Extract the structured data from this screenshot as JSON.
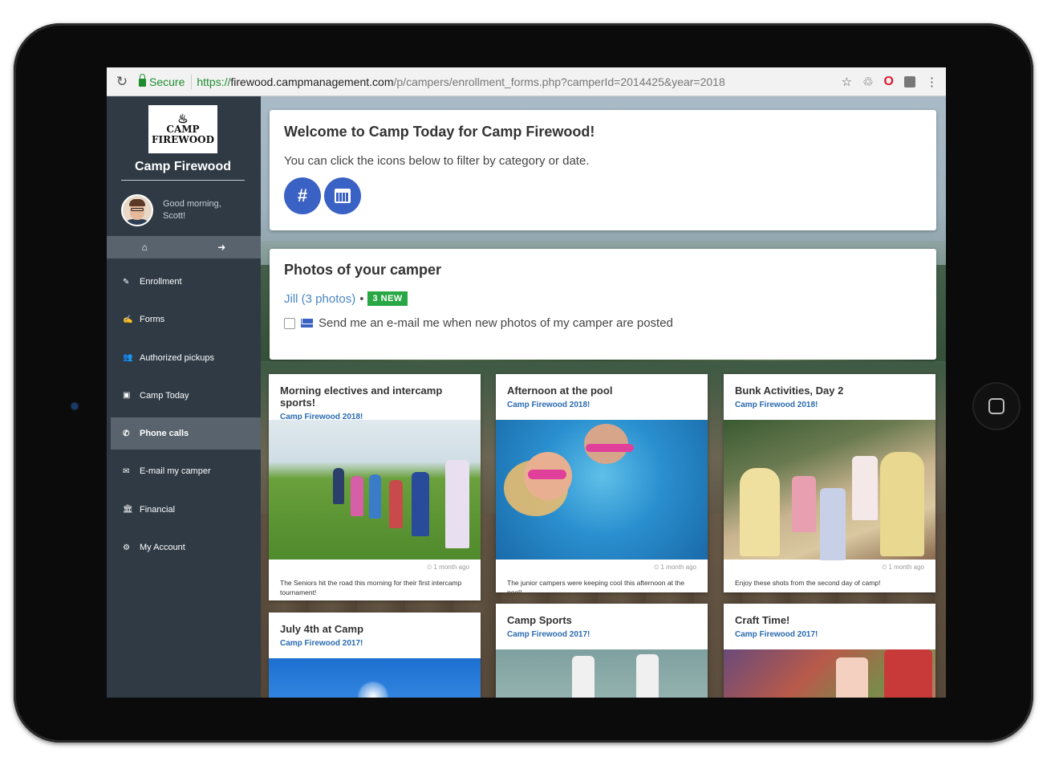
{
  "browser": {
    "secure_label": "Secure",
    "url_scheme": "https://",
    "url_host": "firewood.campmanagement.com",
    "url_path": "/p/campers/enrollment_forms.php?camperId=2014425&year=2018",
    "icons": [
      "reload-icon",
      "star-icon",
      "recycle-icon",
      "opera-icon",
      "extension-icon",
      "menu-icon"
    ]
  },
  "sidebar": {
    "logo_line1": "CAMP",
    "logo_line2": "FIREWOOD",
    "camp_name": "Camp Firewood",
    "greeting_line1": "Good morning,",
    "greeting_line2": "Scott!",
    "quick_icons": [
      "home-icon",
      "sign-out-icon"
    ],
    "items": [
      {
        "label": "Enrollment",
        "icon": "pencil-icon",
        "glyph": "✎"
      },
      {
        "label": "Forms",
        "icon": "edit-icon",
        "glyph": "✍"
      },
      {
        "label": "Authorized pickups",
        "icon": "users-icon",
        "glyph": "👥"
      },
      {
        "label": "Camp Today",
        "icon": "image-icon",
        "glyph": "▣"
      },
      {
        "label": "Phone calls",
        "icon": "phone-icon",
        "glyph": "✆"
      },
      {
        "label": "E-mail my camper",
        "icon": "envelope-icon",
        "glyph": "✉"
      },
      {
        "label": "Financial",
        "icon": "bank-icon",
        "glyph": "🏛"
      },
      {
        "label": "My Account",
        "icon": "gear-icon",
        "glyph": "⚙"
      }
    ],
    "active_item": "Phone calls"
  },
  "welcome": {
    "title": "Welcome to Camp Today for Camp Firewood!",
    "text": "You can click the icons below to filter by category or date.",
    "filter_buttons": [
      "hashtag-icon",
      "calendar-icon"
    ]
  },
  "photos": {
    "title": "Photos of your camper",
    "camper_link": "Jill (3 photos)",
    "separator": "•",
    "new_badge": "3 NEW",
    "notify_label": "Send me an e-mail me when new photos of my camper are posted",
    "notify_checked": false
  },
  "posts": [
    {
      "title": "Morning electives and intercamp sports!",
      "album": "Camp Firewood 2018!",
      "time": "⏲ 1 month ago",
      "caption": "The Seniors hit the road this morning for their first intercamp tournament!"
    },
    {
      "title": "Afternoon at the pool",
      "album": "Camp Firewood 2018!",
      "time": "⏲ 1 month ago",
      "caption": "The junior campers were keeping cool this afternoon at the pool!"
    },
    {
      "title": "Bunk Activities, Day 2",
      "album": "Camp Firewood 2018!",
      "time": "⏲ 1 month ago",
      "caption": "Enjoy these shots from the second day of camp!"
    },
    {
      "title": "July 4th at Camp",
      "album": "Camp Firewood 2017!"
    },
    {
      "title": "Camp Sports",
      "album": "Camp Firewood 2017!"
    },
    {
      "title": "Craft Time!",
      "album": "Camp Firewood 2017!"
    }
  ],
  "colors": {
    "sidebar_bg": "#2f3a45",
    "sidebar_active": "#58636e",
    "accent_blue": "#3a61c4",
    "link_blue": "#4a86c5",
    "badge_green": "#28a745",
    "secure_green": "#1e8c2f"
  }
}
